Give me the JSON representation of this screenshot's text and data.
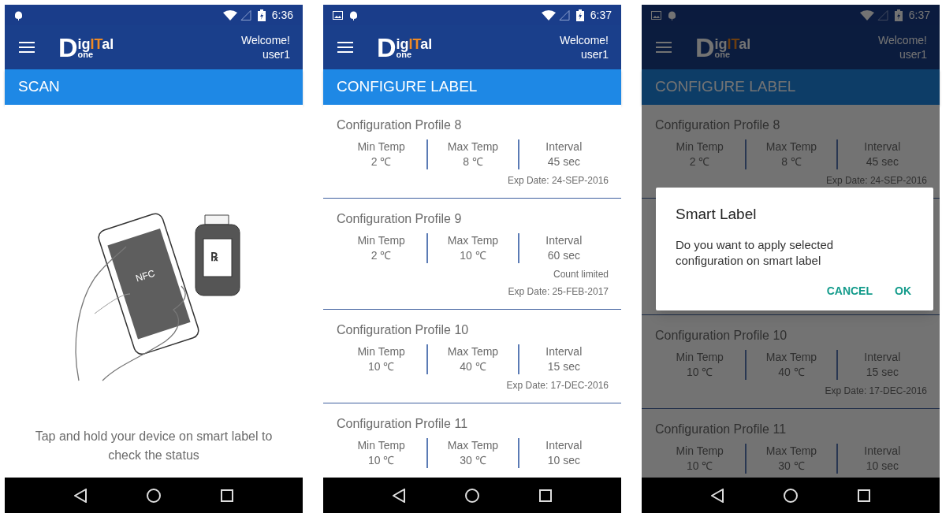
{
  "screens": [
    {
      "kind": "scan",
      "dimmed": false,
      "status_bar": {
        "picture_notification": false,
        "time": "6:36"
      },
      "logo": {
        "initial": "D",
        "word_start": "ig",
        "word_highlight": "IT",
        "word_end": "al",
        "sub": "one"
      },
      "header": {
        "greeting": "Welcome!",
        "user": "user1"
      },
      "title": "SCAN",
      "drawing": {
        "phone_label": "NFC",
        "bottle_label": "℞"
      },
      "instruction": "Tap and hold your device on smart label to check the status"
    },
    {
      "kind": "list",
      "dimmed": false,
      "status_bar": {
        "picture_notification": true,
        "time": "6:37"
      },
      "logo": {
        "initial": "D",
        "word_start": "ig",
        "word_highlight": "IT",
        "word_end": "al",
        "sub": "one"
      },
      "header": {
        "greeting": "Welcome!",
        "user": "user1"
      },
      "title": "CONFIGURE LABEL",
      "profiles": [
        {
          "name": "Configuration Profile 8",
          "columns": [
            {
              "label": "Min Temp",
              "value": "2 ℃"
            },
            {
              "label": "Max Temp",
              "value": "8 ℃"
            },
            {
              "label": "Interval",
              "value": "45 sec"
            }
          ],
          "notes": [
            "Exp Date: 24-SEP-2016"
          ]
        },
        {
          "name": "Configuration Profile 9",
          "columns": [
            {
              "label": "Min Temp",
              "value": "2 ℃"
            },
            {
              "label": "Max Temp",
              "value": "10 ℃"
            },
            {
              "label": "Interval",
              "value": "60 sec"
            }
          ],
          "notes": [
            "Count limited",
            "Exp Date: 25-FEB-2017"
          ]
        },
        {
          "name": "Configuration Profile 10",
          "columns": [
            {
              "label": "Min Temp",
              "value": "10 ℃"
            },
            {
              "label": "Max Temp",
              "value": "40 ℃"
            },
            {
              "label": "Interval",
              "value": "15 sec"
            }
          ],
          "notes": [
            "Exp Date: 17-DEC-2016"
          ]
        },
        {
          "name": "Configuration Profile 11",
          "columns": [
            {
              "label": "Min Temp",
              "value": "10 ℃"
            },
            {
              "label": "Max Temp",
              "value": "30 ℃"
            },
            {
              "label": "Interval",
              "value": "10 sec"
            }
          ]
        }
      ]
    },
    {
      "kind": "list",
      "dimmed": true,
      "status_bar": {
        "picture_notification": true,
        "time": "6:37"
      },
      "logo": {
        "initial": "D",
        "word_start": "ig",
        "word_highlight": "IT",
        "word_end": "al",
        "sub": "one"
      },
      "header": {
        "greeting": "Welcome!",
        "user": "user1"
      },
      "title": "CONFIGURE LABEL",
      "profiles": [
        {
          "name": "Configuration Profile 8",
          "columns": [
            {
              "label": "Min Temp",
              "value": "2 ℃"
            },
            {
              "label": "Max Temp",
              "value": "8 ℃"
            },
            {
              "label": "Interval",
              "value": "45 sec"
            }
          ],
          "notes": [
            "Exp Date: 24-SEP-2016"
          ]
        },
        {
          "name": "Configuration Profile 10",
          "columns": [
            {
              "label": "Min Temp",
              "value": "10 ℃"
            },
            {
              "label": "Max Temp",
              "value": "40 ℃"
            },
            {
              "label": "Interval",
              "value": "15 sec"
            }
          ],
          "notes": [
            "Exp Date: 17-DEC-2016"
          ]
        },
        {
          "name": "Configuration Profile 11",
          "columns": [
            {
              "label": "Min Temp",
              "value": "10 ℃"
            },
            {
              "label": "Max Temp",
              "value": "30 ℃"
            },
            {
              "label": "Interval",
              "value": "10 sec"
            }
          ]
        }
      ],
      "dialog": {
        "title": "Smart Label",
        "message": "Do you want to apply selected configuration on smart label",
        "buttons": [
          "CANCEL",
          "OK"
        ]
      }
    }
  ]
}
